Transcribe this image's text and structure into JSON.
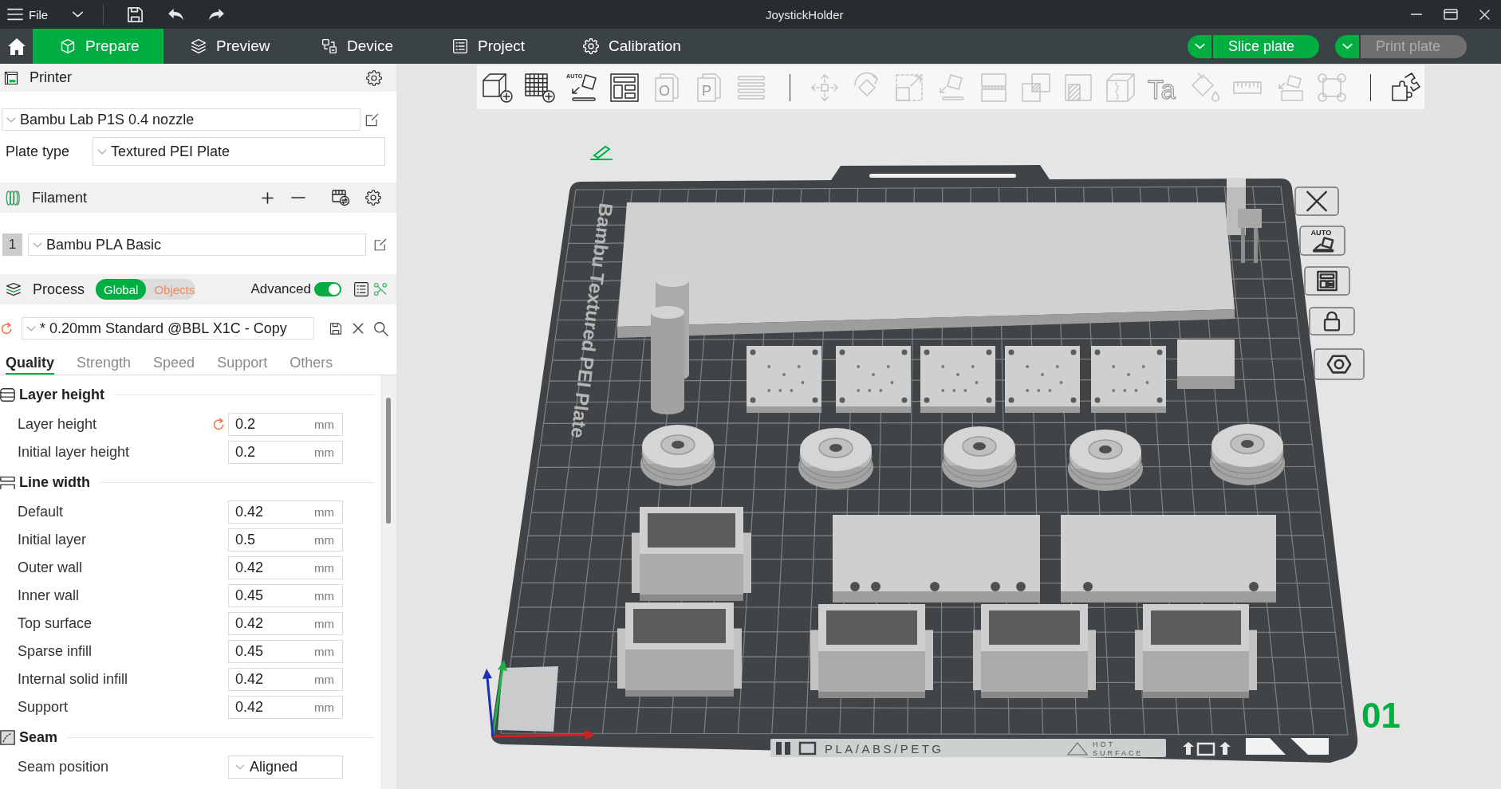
{
  "title_bar": {
    "menu": "File",
    "title": "JoystickHolder"
  },
  "main_tabs": [
    {
      "kind": "prepare",
      "label": "Prepare",
      "selected": true
    },
    {
      "kind": "preview",
      "label": "Preview",
      "selected": false
    },
    {
      "kind": "device",
      "label": "Device",
      "selected": false
    },
    {
      "kind": "project",
      "label": "Project",
      "selected": false
    },
    {
      "kind": "calibration",
      "label": "Calibration",
      "selected": false
    }
  ],
  "actions": [
    {
      "label": "Slice plate",
      "disabled": false
    },
    {
      "label": "Print plate",
      "disabled": true
    }
  ],
  "printer": {
    "title": "Printer",
    "preset": "Bambu Lab P1S 0.4 nozzle",
    "plate_type": {
      "label": "Plate type",
      "value": "Textured PEI Plate"
    }
  },
  "filament": {
    "title": "Filament",
    "slots": [
      {
        "number": "1",
        "preset": "Bambu PLA Basic"
      }
    ]
  },
  "process": {
    "title": "Process",
    "scopes": [
      {
        "label": "Global",
        "selected": true
      },
      {
        "label": "Objects",
        "selected": false
      }
    ],
    "advanced": {
      "label": "Advanced",
      "on": true
    },
    "preset": {
      "value": "* 0.20mm Standard @BBL X1C - Copy",
      "modified": true
    },
    "tabs": [
      {
        "label": "Quality",
        "selected": true
      },
      {
        "label": "Strength",
        "selected": false
      },
      {
        "label": "Speed",
        "selected": false
      },
      {
        "label": "Support",
        "selected": false
      },
      {
        "label": "Others",
        "selected": false
      }
    ],
    "sections": [
      {
        "kind": "layer-height",
        "title": "Layer height",
        "options": [
          {
            "kind": "number",
            "label": "Layer height",
            "value": "0.2",
            "unit": "mm",
            "modified": true
          },
          {
            "kind": "number",
            "label": "Initial layer height",
            "value": "0.2",
            "unit": "mm",
            "modified": false
          }
        ]
      },
      {
        "kind": "line-width",
        "title": "Line width",
        "options": [
          {
            "kind": "number",
            "label": "Default",
            "value": "0.42",
            "unit": "mm",
            "modified": false
          },
          {
            "kind": "number",
            "label": "Initial layer",
            "value": "0.5",
            "unit": "mm",
            "modified": false
          },
          {
            "kind": "number",
            "label": "Outer wall",
            "value": "0.42",
            "unit": "mm",
            "modified": false
          },
          {
            "kind": "number",
            "label": "Inner wall",
            "value": "0.45",
            "unit": "mm",
            "modified": false
          },
          {
            "kind": "number",
            "label": "Top surface",
            "value": "0.42",
            "unit": "mm",
            "modified": false
          },
          {
            "kind": "number",
            "label": "Sparse infill",
            "value": "0.45",
            "unit": "mm",
            "modified": false
          },
          {
            "kind": "number",
            "label": "Internal solid infill",
            "value": "0.42",
            "unit": "mm",
            "modified": false
          },
          {
            "kind": "number",
            "label": "Support",
            "value": "0.42",
            "unit": "mm",
            "modified": false
          }
        ]
      },
      {
        "kind": "seam",
        "title": "Seam",
        "options": [
          {
            "kind": "select",
            "label": "Seam position",
            "value": "Aligned",
            "modified": false
          }
        ]
      }
    ]
  },
  "toolbar": {
    "groups": [
      [
        {
          "kind": "cube-plus",
          "disabled": false
        },
        {
          "kind": "grid-plus",
          "disabled": false
        },
        {
          "kind": "auto-orient",
          "badge": "AUTO",
          "disabled": false
        },
        {
          "kind": "layout",
          "disabled": false
        },
        {
          "kind": "pages",
          "glyph": "O",
          "disabled": true
        },
        {
          "kind": "pages",
          "glyph": "P",
          "disabled": true
        },
        {
          "kind": "lines",
          "disabled": true
        }
      ],
      [
        {
          "kind": "move",
          "disabled": true
        },
        {
          "kind": "rotate",
          "disabled": true
        },
        {
          "kind": "scale",
          "disabled": true
        },
        {
          "kind": "lay-flat",
          "disabled": true
        },
        {
          "kind": "split",
          "disabled": true
        },
        {
          "kind": "overlap",
          "disabled": true
        },
        {
          "kind": "hatched-corner",
          "disabled": true
        },
        {
          "kind": "cube",
          "disabled": true
        },
        {
          "kind": "text",
          "glyph": "Ta",
          "disabled": true
        },
        {
          "kind": "paint-bucket",
          "disabled": true
        },
        {
          "kind": "ruler",
          "disabled": true
        },
        {
          "kind": "tilted-box",
          "disabled": true
        },
        {
          "kind": "square-corners",
          "disabled": true
        }
      ],
      [
        {
          "kind": "puzzle",
          "disabled": false
        }
      ]
    ]
  },
  "plate": {
    "name": "Bambu Textured PEI Plate",
    "material": "PLA/ABS/PETG",
    "warning": [
      "HOT",
      "SURFACE"
    ],
    "number": "01"
  },
  "plate_controls": [
    {
      "kind": "delete"
    },
    {
      "kind": "auto-orient",
      "badge": "AUTO"
    },
    {
      "kind": "arrange"
    },
    {
      "kind": "lock"
    },
    {
      "kind": "settings"
    }
  ]
}
